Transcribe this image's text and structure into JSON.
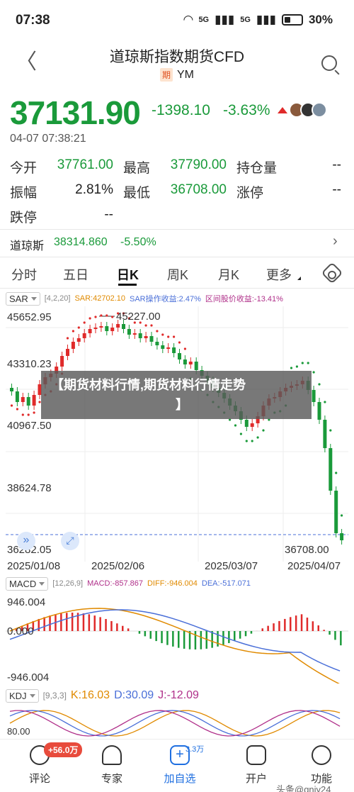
{
  "status": {
    "time": "07:38",
    "battery": "30%",
    "net1": "5G",
    "net2": "5G"
  },
  "header": {
    "title": "道琼斯指数期货CFD",
    "badge": "期",
    "code": "YM"
  },
  "quote": {
    "price": "37131.90",
    "change": "-1398.10",
    "change_pct": "-3.63%",
    "datetime": "04-07 07:38:21",
    "stats": [
      [
        {
          "label": "今开",
          "value": "37761.00"
        },
        {
          "label": "最高",
          "value": "37790.00"
        },
        {
          "label": "持仓量",
          "value": "--"
        }
      ],
      [
        {
          "label": "振幅",
          "value": "2.81%"
        },
        {
          "label": "最低",
          "value": "36708.00"
        },
        {
          "label": "涨停",
          "value": "--"
        }
      ],
      [
        {
          "label": "跌停",
          "value": "--"
        }
      ]
    ]
  },
  "index_row": {
    "name": "道琼斯",
    "value": "38314.860",
    "pct": "-5.50%"
  },
  "tabs": [
    "分时",
    "五日",
    "日K",
    "周K",
    "月K",
    "更多"
  ],
  "sar_bar": {
    "name": "SAR",
    "params": "[4,2,20]",
    "sar": "SAR:42702.10",
    "op": "SAR操作收益:2.47%",
    "bt": "区间股价收益:-13.41%"
  },
  "main_chart": {
    "y_labels": [
      "45652.95",
      "43310.23",
      "40967.50",
      "38624.78",
      "36282.05"
    ],
    "x_labels": [
      "2025/01/08",
      "2025/02/06",
      "2025/03/07",
      "2025/04/07"
    ],
    "high_mark": "45227.00",
    "low_mark": "36708.00"
  },
  "banner": {
    "line1": "【期货材料行情,期货材料行情走势",
    "line2": "】"
  },
  "macd_bar": {
    "name": "MACD",
    "params": "[12,26,9]",
    "macd": "MACD:-857.867",
    "diff": "DIFF:-946.004",
    "dea": "DEA:-517.071"
  },
  "macd_chart": {
    "y_labels": [
      "946.004",
      "0.000",
      "-946.004"
    ]
  },
  "kdj_bar": {
    "name": "KDJ",
    "params": "[9,3,3]",
    "k": "K:16.03",
    "d": "D:30.09",
    "j": "J:-12.09"
  },
  "kdj_chart": {
    "y_labels": [
      "80.00"
    ]
  },
  "bottom_nav": [
    {
      "label": "评论",
      "icon": "comment-icon"
    },
    {
      "label": "专家",
      "icon": "expert-icon"
    },
    {
      "label": "加自选",
      "icon": "add-watchlist-icon"
    },
    {
      "label": "开户",
      "icon": "open-account-icon"
    },
    {
      "label": "功能",
      "icon": "menu-icon"
    }
  ],
  "nav_badges": {
    "comments": "+56.0万",
    "watch": "3.3万"
  },
  "watermark": "头条@gnjy24",
  "colors": {
    "up": "#e02a2a",
    "down": "#1a9a3a",
    "sar": "#e02a2a",
    "accent": "#1f6fe0"
  }
}
